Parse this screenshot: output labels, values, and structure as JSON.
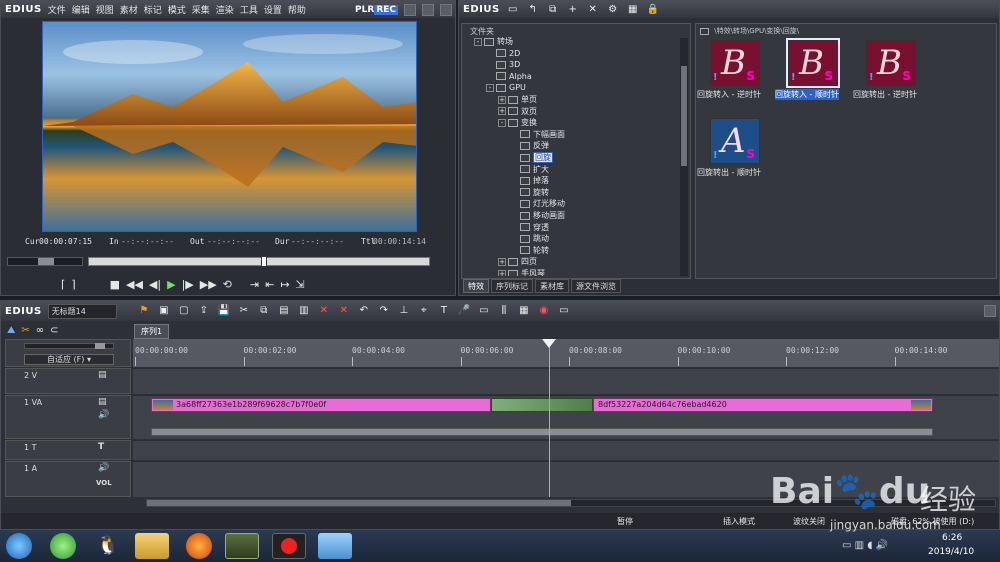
{
  "player": {
    "app_name": "EDIUS",
    "menus": [
      "文件",
      "编辑",
      "视图",
      "素材",
      "标记",
      "模式",
      "采集",
      "渲染",
      "工具",
      "设置",
      "帮助"
    ],
    "plr_label": "PLR",
    "rec_label": "REC",
    "timecodes": {
      "cur_label": "Cur",
      "cur_value": "00:00:07:15",
      "in_label": "In",
      "in_value": "--:--:--:--",
      "out_label": "Out",
      "out_value": "--:--:--:--",
      "dur_label": "Dur",
      "dur_value": "--:--:--:--",
      "ttl_label": "Ttl",
      "ttl_value": "00:00:14:14"
    }
  },
  "library": {
    "app_name": "EDIUS",
    "folder_header": "文件夹",
    "path": "\\特效\\转场\\GPU\\变换\\回旋\\",
    "tree": [
      {
        "label": "转场",
        "indent": 1,
        "exp": "-"
      },
      {
        "label": "2D",
        "indent": 2,
        "exp": ""
      },
      {
        "label": "3D",
        "indent": 2,
        "exp": ""
      },
      {
        "label": "Alpha",
        "indent": 2,
        "exp": ""
      },
      {
        "label": "GPU",
        "indent": 2,
        "exp": "-"
      },
      {
        "label": "单页",
        "indent": 3,
        "exp": "+"
      },
      {
        "label": "双页",
        "indent": 3,
        "exp": "+"
      },
      {
        "label": "变换",
        "indent": 3,
        "exp": "-"
      },
      {
        "label": "下幅画面",
        "indent": 4,
        "exp": ""
      },
      {
        "label": "反弹",
        "indent": 4,
        "exp": ""
      },
      {
        "label": "回旋",
        "indent": 4,
        "exp": "",
        "selected": true
      },
      {
        "label": "扩大",
        "indent": 4,
        "exp": ""
      },
      {
        "label": "掉落",
        "indent": 4,
        "exp": ""
      },
      {
        "label": "旋转",
        "indent": 4,
        "exp": ""
      },
      {
        "label": "灯光移动",
        "indent": 4,
        "exp": ""
      },
      {
        "label": "移动画面",
        "indent": 4,
        "exp": ""
      },
      {
        "label": "穿透",
        "indent": 4,
        "exp": ""
      },
      {
        "label": "跳动",
        "indent": 4,
        "exp": ""
      },
      {
        "label": "轮转",
        "indent": 4,
        "exp": ""
      },
      {
        "label": "四页",
        "indent": 3,
        "exp": "+"
      },
      {
        "label": "手风琴",
        "indent": 3,
        "exp": "+"
      }
    ],
    "effects": [
      {
        "label": "回旋转入 - 逆时针",
        "letter": "B",
        "selected": false
      },
      {
        "label": "回旋转入 - 顺时针",
        "letter": "B",
        "selected": true
      },
      {
        "label": "回旋转出 - 逆时针",
        "letter": "B",
        "selected": false
      },
      {
        "label": "回旋转出 - 顺时针",
        "letter": "A",
        "selected": false
      }
    ],
    "tabs": [
      "特效",
      "序列标记",
      "素材库",
      "源文件浏览"
    ]
  },
  "timeline": {
    "app_name": "EDIUS",
    "project_name": "无标题14",
    "sequence_tab": "序列1",
    "ruler": [
      "00:00:00:00",
      "00:00:02:00",
      "00:00:04:00",
      "00:00:06:00",
      "00:00:08:00",
      "00:00:10:00",
      "00:00:12:00",
      "00:00:14:00"
    ],
    "adaptive_label": "自适应 (F)",
    "tracks": {
      "v2": "2 V",
      "va1": "1 VA",
      "t1": "1 T",
      "a1": "1 A",
      "vol_label": "VOL"
    },
    "clip_a": "3a68ff27363e1b289f69628c7b7f0e0f",
    "clip_b": "8df53227a204d64c76ebad4620"
  },
  "statusbar": {
    "pause": "暂停",
    "insert_mode": "插入模式",
    "ripple_off": "波纹关闭",
    "disk": "磁盘: 62% 被使用 (D:)"
  },
  "taskbar": {
    "time": "6:26",
    "date": "2019/4/10"
  },
  "watermark": {
    "brand": "Bai",
    "brand2": "du",
    "jingyan": "经验",
    "url": "jingyan.baidu.com"
  },
  "colors": {
    "clip_pink": "#e86bd6",
    "selection_blue": "#2a62c8",
    "rec_blue": "#3b6fe0"
  }
}
